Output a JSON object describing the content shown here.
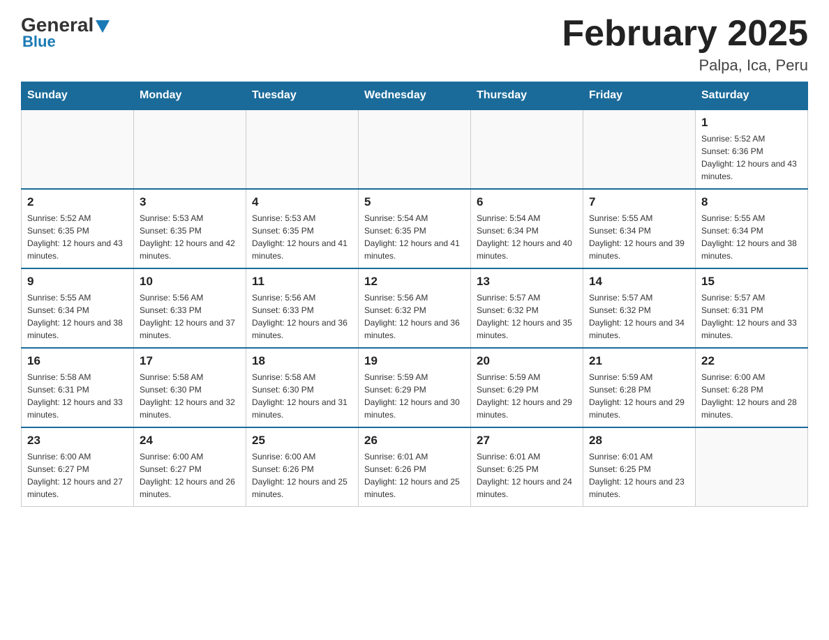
{
  "header": {
    "logo_general": "General",
    "logo_blue": "Blue",
    "month_title": "February 2025",
    "location": "Palpa, Ica, Peru"
  },
  "days_of_week": [
    "Sunday",
    "Monday",
    "Tuesday",
    "Wednesday",
    "Thursday",
    "Friday",
    "Saturday"
  ],
  "weeks": [
    [
      {
        "day": "",
        "info": ""
      },
      {
        "day": "",
        "info": ""
      },
      {
        "day": "",
        "info": ""
      },
      {
        "day": "",
        "info": ""
      },
      {
        "day": "",
        "info": ""
      },
      {
        "day": "",
        "info": ""
      },
      {
        "day": "1",
        "info": "Sunrise: 5:52 AM\nSunset: 6:36 PM\nDaylight: 12 hours and 43 minutes."
      }
    ],
    [
      {
        "day": "2",
        "info": "Sunrise: 5:52 AM\nSunset: 6:35 PM\nDaylight: 12 hours and 43 minutes."
      },
      {
        "day": "3",
        "info": "Sunrise: 5:53 AM\nSunset: 6:35 PM\nDaylight: 12 hours and 42 minutes."
      },
      {
        "day": "4",
        "info": "Sunrise: 5:53 AM\nSunset: 6:35 PM\nDaylight: 12 hours and 41 minutes."
      },
      {
        "day": "5",
        "info": "Sunrise: 5:54 AM\nSunset: 6:35 PM\nDaylight: 12 hours and 41 minutes."
      },
      {
        "day": "6",
        "info": "Sunrise: 5:54 AM\nSunset: 6:34 PM\nDaylight: 12 hours and 40 minutes."
      },
      {
        "day": "7",
        "info": "Sunrise: 5:55 AM\nSunset: 6:34 PM\nDaylight: 12 hours and 39 minutes."
      },
      {
        "day": "8",
        "info": "Sunrise: 5:55 AM\nSunset: 6:34 PM\nDaylight: 12 hours and 38 minutes."
      }
    ],
    [
      {
        "day": "9",
        "info": "Sunrise: 5:55 AM\nSunset: 6:34 PM\nDaylight: 12 hours and 38 minutes."
      },
      {
        "day": "10",
        "info": "Sunrise: 5:56 AM\nSunset: 6:33 PM\nDaylight: 12 hours and 37 minutes."
      },
      {
        "day": "11",
        "info": "Sunrise: 5:56 AM\nSunset: 6:33 PM\nDaylight: 12 hours and 36 minutes."
      },
      {
        "day": "12",
        "info": "Sunrise: 5:56 AM\nSunset: 6:32 PM\nDaylight: 12 hours and 36 minutes."
      },
      {
        "day": "13",
        "info": "Sunrise: 5:57 AM\nSunset: 6:32 PM\nDaylight: 12 hours and 35 minutes."
      },
      {
        "day": "14",
        "info": "Sunrise: 5:57 AM\nSunset: 6:32 PM\nDaylight: 12 hours and 34 minutes."
      },
      {
        "day": "15",
        "info": "Sunrise: 5:57 AM\nSunset: 6:31 PM\nDaylight: 12 hours and 33 minutes."
      }
    ],
    [
      {
        "day": "16",
        "info": "Sunrise: 5:58 AM\nSunset: 6:31 PM\nDaylight: 12 hours and 33 minutes."
      },
      {
        "day": "17",
        "info": "Sunrise: 5:58 AM\nSunset: 6:30 PM\nDaylight: 12 hours and 32 minutes."
      },
      {
        "day": "18",
        "info": "Sunrise: 5:58 AM\nSunset: 6:30 PM\nDaylight: 12 hours and 31 minutes."
      },
      {
        "day": "19",
        "info": "Sunrise: 5:59 AM\nSunset: 6:29 PM\nDaylight: 12 hours and 30 minutes."
      },
      {
        "day": "20",
        "info": "Sunrise: 5:59 AM\nSunset: 6:29 PM\nDaylight: 12 hours and 29 minutes."
      },
      {
        "day": "21",
        "info": "Sunrise: 5:59 AM\nSunset: 6:28 PM\nDaylight: 12 hours and 29 minutes."
      },
      {
        "day": "22",
        "info": "Sunrise: 6:00 AM\nSunset: 6:28 PM\nDaylight: 12 hours and 28 minutes."
      }
    ],
    [
      {
        "day": "23",
        "info": "Sunrise: 6:00 AM\nSunset: 6:27 PM\nDaylight: 12 hours and 27 minutes."
      },
      {
        "day": "24",
        "info": "Sunrise: 6:00 AM\nSunset: 6:27 PM\nDaylight: 12 hours and 26 minutes."
      },
      {
        "day": "25",
        "info": "Sunrise: 6:00 AM\nSunset: 6:26 PM\nDaylight: 12 hours and 25 minutes."
      },
      {
        "day": "26",
        "info": "Sunrise: 6:01 AM\nSunset: 6:26 PM\nDaylight: 12 hours and 25 minutes."
      },
      {
        "day": "27",
        "info": "Sunrise: 6:01 AM\nSunset: 6:25 PM\nDaylight: 12 hours and 24 minutes."
      },
      {
        "day": "28",
        "info": "Sunrise: 6:01 AM\nSunset: 6:25 PM\nDaylight: 12 hours and 23 minutes."
      },
      {
        "day": "",
        "info": ""
      }
    ]
  ]
}
